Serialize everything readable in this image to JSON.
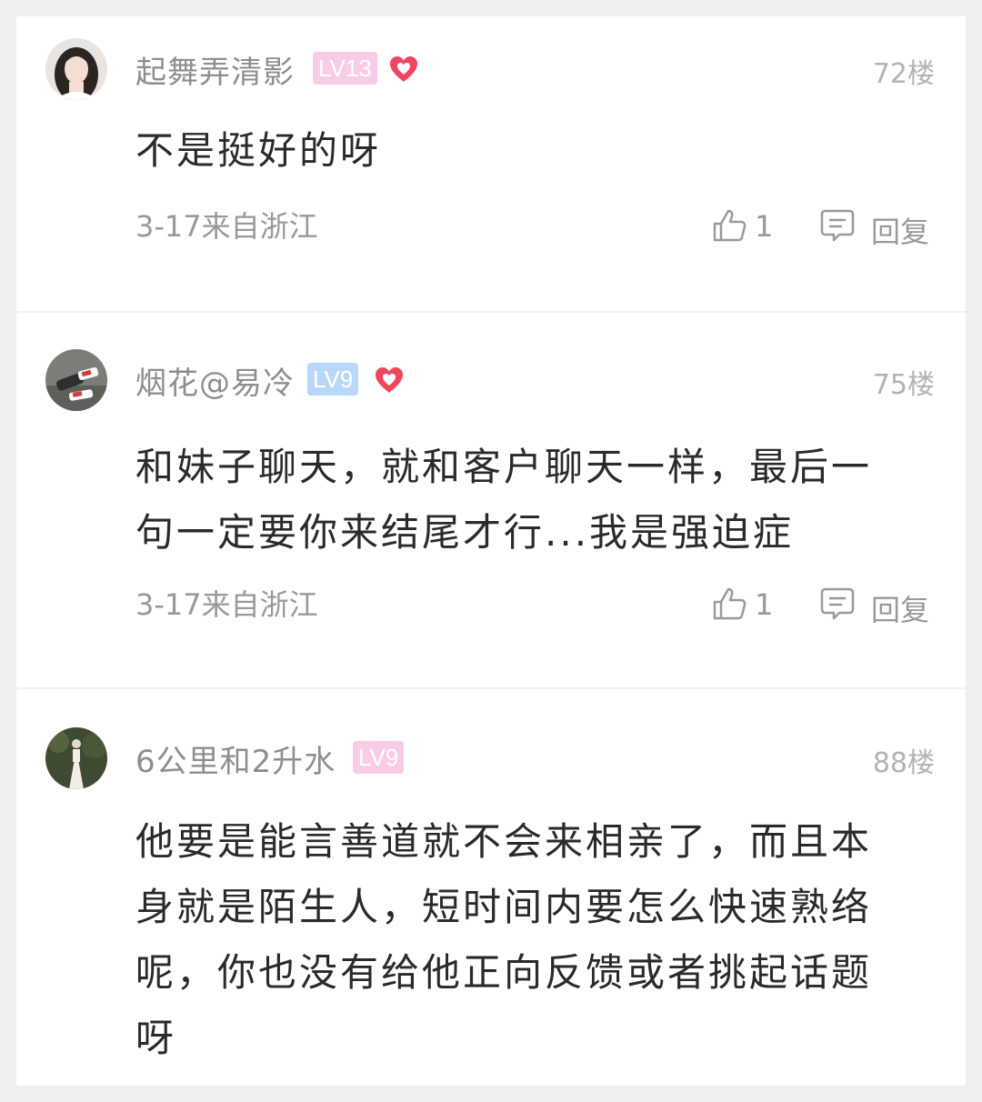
{
  "comments": [
    {
      "username": "起舞弄清影",
      "level": "LV13",
      "floor": "72楼",
      "text": "不是挺好的呀",
      "meta": "3-17来自浙江",
      "likes": "1",
      "reply_label": "回复"
    },
    {
      "username": "烟花@易冷",
      "level": "LV9",
      "floor": "75楼",
      "text": "和妹子聊天，就和客户聊天一样，最后一句一定要你来结尾才行...我是强迫症",
      "meta": "3-17来自浙江",
      "likes": "1",
      "reply_label": "回复"
    },
    {
      "username": "6公里和2升水",
      "level": "LV9",
      "floor": "88楼",
      "text": "他要是能言善道就不会来相亲了，而且本身就是陌生人，短时间内要怎么快速熟络呢，你也没有给他正向反馈或者挑起话题呀"
    }
  ],
  "colors": {
    "level_pink": "#f8cbe6",
    "level_blue": "#b9d7f8",
    "heart": "#f0455f"
  }
}
